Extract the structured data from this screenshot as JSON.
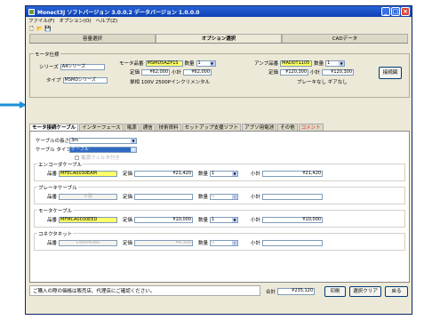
{
  "titlebar": {
    "text": "Monect3J  ソフトバージョン 3.0.0.2  データバージョン 1.0.0.0"
  },
  "menu": [
    "ファイル(F)",
    "オプション(O)",
    "ヘルプ(Z)"
  ],
  "top_tabs": [
    "容量選択",
    "オプション選択",
    "CADデータ"
  ],
  "motor_spec": {
    "label": "モータ仕様",
    "series_label": "シリーズ",
    "series_value": "A4シリーズ",
    "type_label": "タイプ",
    "type_value": "MSMDシリーズ",
    "motor_label": "モータ品番",
    "motor_value": "MSMD5AZP1S",
    "qty_label": "数量",
    "qty_value": "1",
    "price_label": "定価",
    "price_value": "¥62,000",
    "subtotal_label": "小計",
    "subtotal_value": "¥62,000",
    "unit_text": "単相 100V  2500Pインクリメンタル",
    "amp_label": "アンプ品番",
    "amp_value": "MADDT1105",
    "amp_qty_value": "1",
    "amp_price_value": "¥120,300",
    "amp_subtotal_value": "¥120,300",
    "amp_note": "ブレーキなし  ギアなし",
    "select_button": "接続図"
  },
  "inner_tabs": [
    "モータ接続ケーブル",
    "インターフェース",
    "電源",
    "通信",
    "技術資料",
    "セットアップ支援ソフト",
    "アブソ用電池",
    "その他",
    "コメント"
  ],
  "cable": {
    "length_label": "ケーブルの長さ",
    "length_value": "3m",
    "type_label": "ケーブル タイプ",
    "type_value": "ケーブル",
    "checkbox_label": "電源フィルタ付き"
  },
  "sections": [
    {
      "title": "エンコーダケーブル",
      "part": "MFECA0030EAM",
      "price": "¥21,420",
      "qty": "1",
      "subtotal": "¥21,420",
      "disabled": false
    },
    {
      "title": "ブレーキケーブル",
      "part": "不要",
      "price": "",
      "qty": "0",
      "subtotal": "",
      "disabled": true
    },
    {
      "title": "モータケーブル",
      "part": "MFMCA0030EED",
      "price": "¥10,000",
      "qty": "1",
      "subtotal": "¥10,000",
      "disabled": false
    },
    {
      "title": "コネクタキット",
      "part": "DV0P4380",
      "price": "¥4,300",
      "qty": "0",
      "subtotal": "",
      "disabled": true
    }
  ],
  "labels": {
    "part": "品番",
    "price": "定価",
    "qty": "数量",
    "subtotal": "小計"
  },
  "footer": {
    "notice": "ご購入の際の価格は販売店、代理店にご確認ください。",
    "total_label": "合計",
    "total_value": "¥235,120",
    "print_button": "印刷",
    "clear_button": "選択クリア",
    "back_button": "戻る"
  }
}
